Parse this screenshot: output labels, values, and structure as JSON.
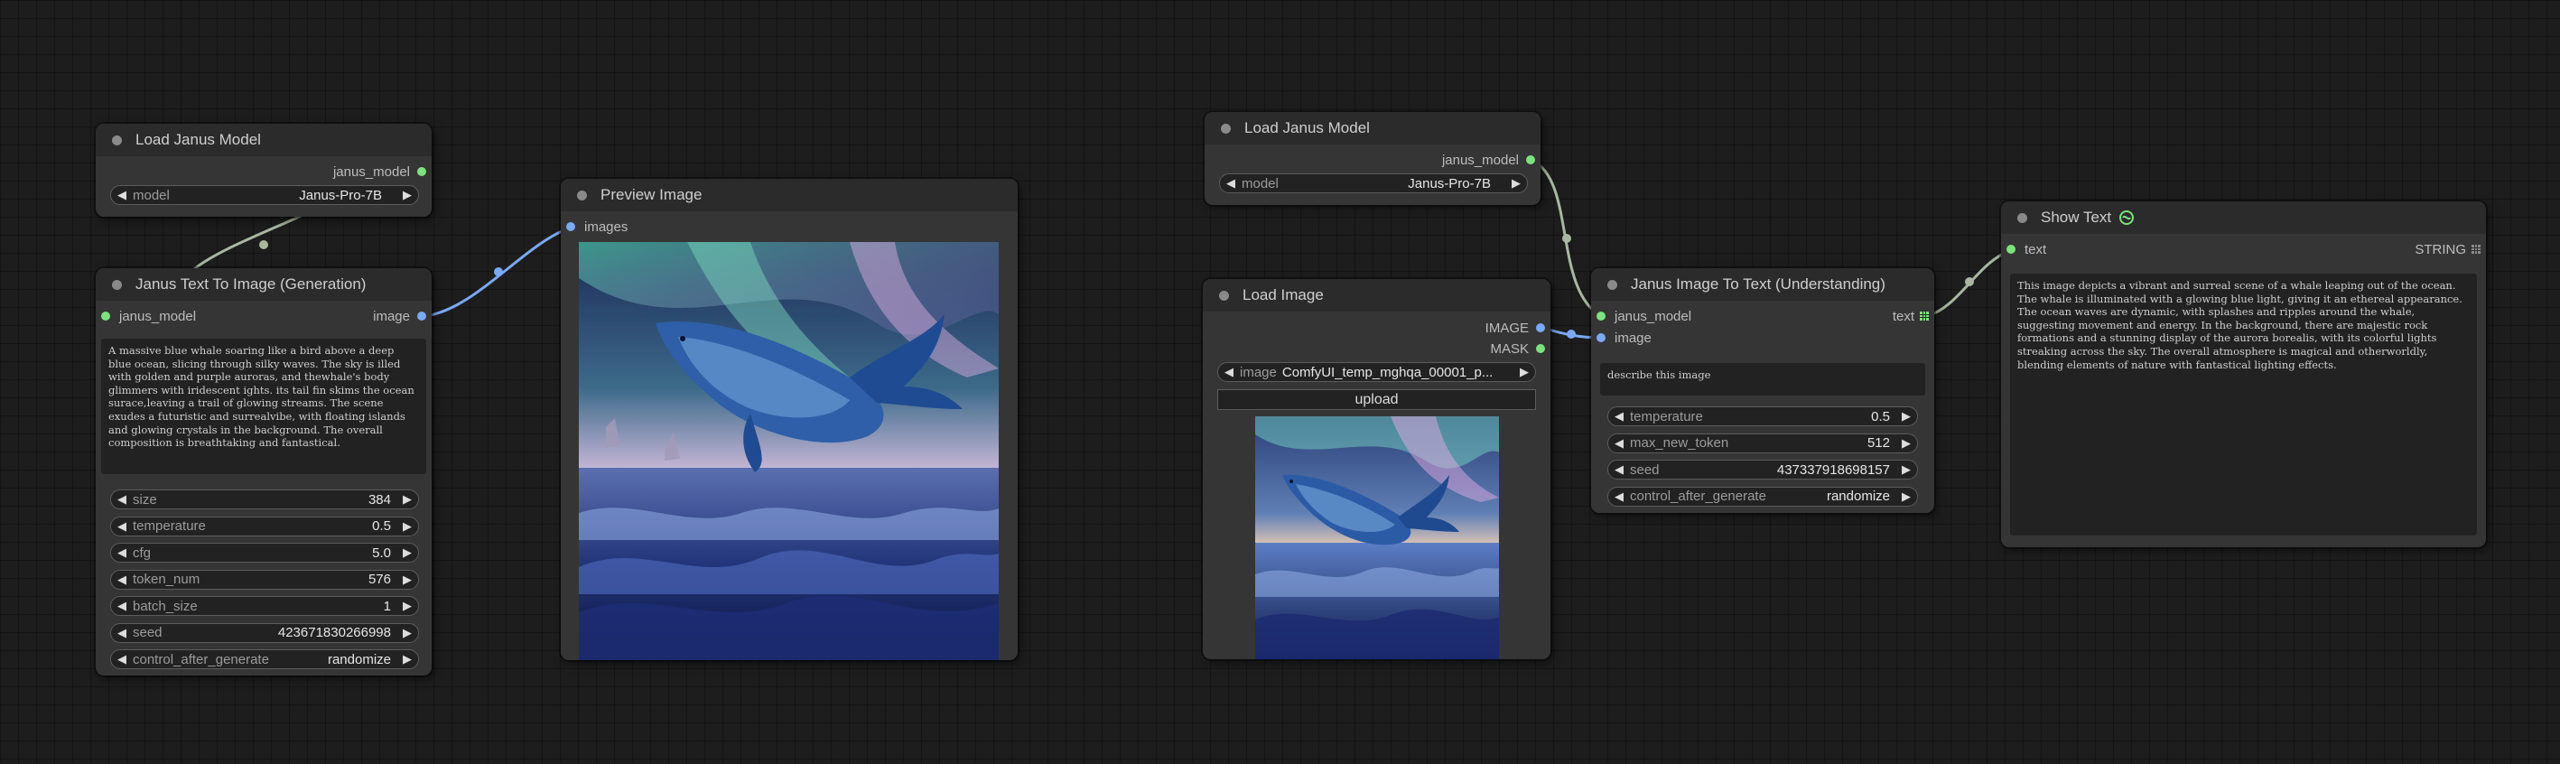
{
  "colors": {
    "background": "#1d1d1d",
    "node_body": "#353535",
    "node_title": "#2b2b2b",
    "slot_model": "#7de27d",
    "slot_image": "#7aa9f5",
    "wire_model": "#a8b8a0",
    "wire_image": "#7aa9f5"
  },
  "nodes": {
    "load_janus_left": {
      "title": "Load Janus Model",
      "output": "janus_model",
      "widget": {
        "label": "model",
        "value": "Janus-Pro-7B"
      }
    },
    "text_to_image": {
      "title": "Janus Text To Image (Generation)",
      "input": "janus_model",
      "output": "image",
      "prompt": "A massive blue whale soaring like a bird above a deep blue ocean, slicing through silky waves. The sky is illed with golden and purple auroras, and thewhale's body glimmers with iridescent ights. its tail fin skims the ocean surace,leaving a trail of glowing streams. The scene exudes a futuristic and surrealvibe, with floating islands and glowing crystals in the background. The overall composition is breathtaking and fantastical.",
      "widgets": [
        {
          "label": "size",
          "value": "384"
        },
        {
          "label": "temperature",
          "value": "0.5"
        },
        {
          "label": "cfg",
          "value": "5.0"
        },
        {
          "label": "token_num",
          "value": "576"
        },
        {
          "label": "batch_size",
          "value": "1"
        },
        {
          "label": "seed",
          "value": "423671830266998"
        },
        {
          "label": "control_after_generate",
          "value": "randomize"
        }
      ]
    },
    "preview_image": {
      "title": "Preview Image",
      "input": "images"
    },
    "load_janus_right": {
      "title": "Load Janus Model",
      "output": "janus_model",
      "widget": {
        "label": "model",
        "value": "Janus-Pro-7B"
      }
    },
    "load_image": {
      "title": "Load Image",
      "outputs": [
        "IMAGE",
        "MASK"
      ],
      "widget": {
        "label": "image",
        "value": "ComfyUI_temp_mghqa_00001_p..."
      },
      "upload_label": "upload"
    },
    "image_to_text": {
      "title": "Janus Image To Text (Understanding)",
      "inputs": [
        "janus_model",
        "image"
      ],
      "output": "text",
      "question": "describe this image",
      "widgets": [
        {
          "label": "temperature",
          "value": "0.5"
        },
        {
          "label": "max_new_token",
          "value": "512"
        },
        {
          "label": "seed",
          "value": "437337918698157"
        },
        {
          "label": "control_after_generate",
          "value": "randomize"
        }
      ]
    },
    "show_text": {
      "title": "Show Text",
      "title_icon": "snake-icon",
      "input": "text",
      "output": "STRING",
      "text": "This image depicts a vibrant and surreal scene of a whale leaping out of the ocean. The whale is illuminated with a glowing blue light, giving it an ethereal appearance. The ocean waves are dynamic, with splashes and ripples around the whale, suggesting movement and energy. In the background, there are majestic rock formations and a stunning display of the aurora borealis, with its colorful lights streaking across the sky. The overall atmosphere is magical and otherworldly, blending elements of nature with fantastical lighting effects."
    }
  }
}
